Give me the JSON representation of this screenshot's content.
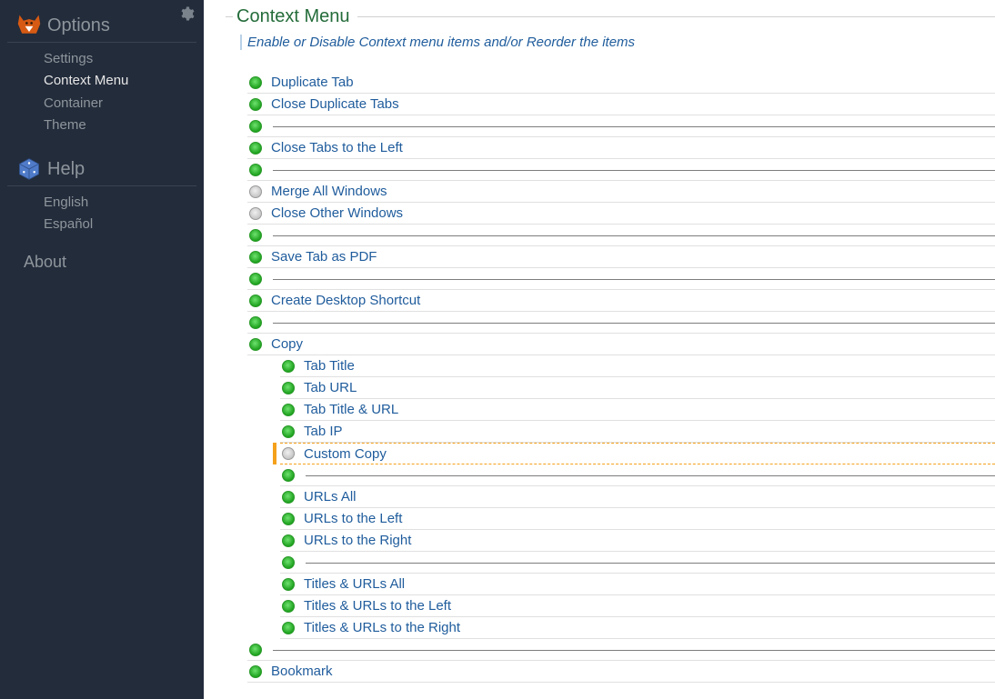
{
  "sidebar": {
    "options_title": "Options",
    "help_title": "Help",
    "about": "About",
    "items": [
      {
        "label": "Settings",
        "active": false
      },
      {
        "label": "Context Menu",
        "active": true
      },
      {
        "label": "Container",
        "active": false
      },
      {
        "label": "Theme",
        "active": false
      }
    ],
    "help_items": [
      {
        "label": "English"
      },
      {
        "label": "Español"
      }
    ]
  },
  "page": {
    "title": "Context Menu",
    "subtitle": "Enable or Disable Context menu items and/or Reorder the items"
  },
  "rows": [
    {
      "label": "Duplicate Tab",
      "on": true,
      "sub": false,
      "sep": false,
      "hl": false
    },
    {
      "label": "Close Duplicate Tabs",
      "on": true,
      "sub": false,
      "sep": false,
      "hl": false
    },
    {
      "label": "",
      "on": true,
      "sub": false,
      "sep": true,
      "hl": false
    },
    {
      "label": "Close Tabs to the Left",
      "on": true,
      "sub": false,
      "sep": false,
      "hl": false
    },
    {
      "label": "",
      "on": true,
      "sub": false,
      "sep": true,
      "hl": false
    },
    {
      "label": "Merge All Windows",
      "on": false,
      "sub": false,
      "sep": false,
      "hl": false
    },
    {
      "label": "Close Other Windows",
      "on": false,
      "sub": false,
      "sep": false,
      "hl": false
    },
    {
      "label": "",
      "on": true,
      "sub": false,
      "sep": true,
      "hl": false
    },
    {
      "label": "Save Tab as PDF",
      "on": true,
      "sub": false,
      "sep": false,
      "hl": false
    },
    {
      "label": "",
      "on": true,
      "sub": false,
      "sep": true,
      "hl": false
    },
    {
      "label": "Create Desktop Shortcut",
      "on": true,
      "sub": false,
      "sep": false,
      "hl": false
    },
    {
      "label": "",
      "on": true,
      "sub": false,
      "sep": true,
      "hl": false
    },
    {
      "label": "Copy",
      "on": true,
      "sub": false,
      "sep": false,
      "hl": false
    },
    {
      "label": "Tab Title",
      "on": true,
      "sub": true,
      "sep": false,
      "hl": false
    },
    {
      "label": "Tab URL",
      "on": true,
      "sub": true,
      "sep": false,
      "hl": false
    },
    {
      "label": "Tab Title & URL",
      "on": true,
      "sub": true,
      "sep": false,
      "hl": false
    },
    {
      "label": "Tab IP",
      "on": true,
      "sub": true,
      "sep": false,
      "hl": false
    },
    {
      "label": "Custom Copy",
      "on": false,
      "sub": true,
      "sep": false,
      "hl": true
    },
    {
      "label": "",
      "on": true,
      "sub": true,
      "sep": true,
      "hl": false
    },
    {
      "label": "URLs All",
      "on": true,
      "sub": true,
      "sep": false,
      "hl": false
    },
    {
      "label": "URLs to the Left",
      "on": true,
      "sub": true,
      "sep": false,
      "hl": false
    },
    {
      "label": "URLs to the Right",
      "on": true,
      "sub": true,
      "sep": false,
      "hl": false
    },
    {
      "label": "",
      "on": true,
      "sub": true,
      "sep": true,
      "hl": false
    },
    {
      "label": "Titles & URLs All",
      "on": true,
      "sub": true,
      "sep": false,
      "hl": false
    },
    {
      "label": "Titles & URLs to the Left",
      "on": true,
      "sub": true,
      "sep": false,
      "hl": false
    },
    {
      "label": "Titles & URLs to the Right",
      "on": true,
      "sub": true,
      "sep": false,
      "hl": false
    },
    {
      "label": "",
      "on": true,
      "sub": false,
      "sep": true,
      "hl": false
    },
    {
      "label": "Bookmark",
      "on": true,
      "sub": false,
      "sep": false,
      "hl": false
    }
  ]
}
